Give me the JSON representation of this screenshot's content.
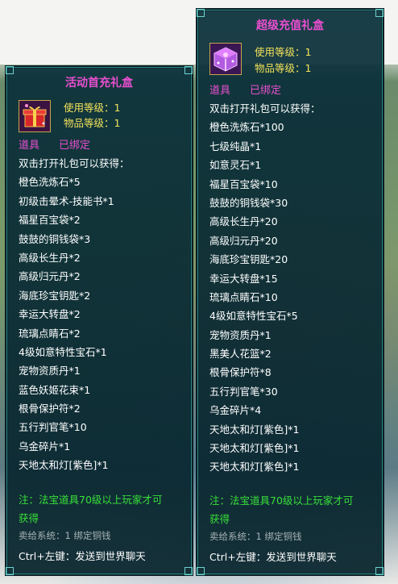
{
  "left_panel": {
    "title": "活动首充礼盒",
    "use_level": "使用等级：1",
    "item_level": "物品等级：1",
    "category": "道具",
    "bound_status": "已绑定",
    "intro": "双击打开礼包可以获得：",
    "items": [
      "橙色洗炼石*5",
      "初级击晕术-技能书*1",
      "福星百宝袋*2",
      "鼓鼓的铜钱袋*3",
      "高级长生丹*2",
      "高级归元丹*2",
      "海底珍宝钥匙*2",
      "幸运大转盘*2",
      "琉璃点睛石*2",
      "4级如意特性宝石*1",
      "宠物资质丹*1",
      "蓝色妖姬花束*1",
      "根骨保护符*2",
      "五行判官笔*10",
      "乌金碎片*1",
      "天地太和灯[紫色]*1"
    ],
    "note_line1": "注：法宝道具70级以上玩家才可",
    "note_line2": "获得",
    "sell": "卖给系统：1 绑定铜钱",
    "ctrl_hint": "Ctrl+左键：发送到世界聊天"
  },
  "right_panel": {
    "title": "超级充值礼盒",
    "use_level": "使用等级：1",
    "item_level": "物品等级：1",
    "category": "道具",
    "bound_status": "已绑定",
    "intro": "双击打开礼包可以获得：",
    "items": [
      "橙色洗炼石*100",
      "七级纯晶*1",
      "如意灵石*1",
      "福星百宝袋*10",
      "鼓鼓的铜钱袋*30",
      "高级长生丹*20",
      "高级归元丹*20",
      "海底珍宝钥匙*20",
      "幸运大转盘*15",
      "琉璃点睛石*10",
      "4级如意特性宝石*5",
      "宠物资质丹*1",
      "黑美人花篮*2",
      "根骨保护符*8",
      "五行判官笔*30",
      "乌金碎片*4",
      "天地太和灯[紫色]*1",
      "天地太和灯[紫色]*1",
      "天地太和灯[紫色]*1"
    ],
    "note_line1": "注：法宝道具70级以上玩家才可",
    "note_line2": "获得",
    "sell": "卖给系统：1 绑定铜钱",
    "ctrl_hint": "Ctrl+左键：发送到世界聊天"
  },
  "colors": {
    "title": "#e94fd0",
    "level_text": "#f3e25a",
    "note": "#38e038",
    "panel_bg": "#0a303a",
    "border": "#2f8a8a"
  }
}
